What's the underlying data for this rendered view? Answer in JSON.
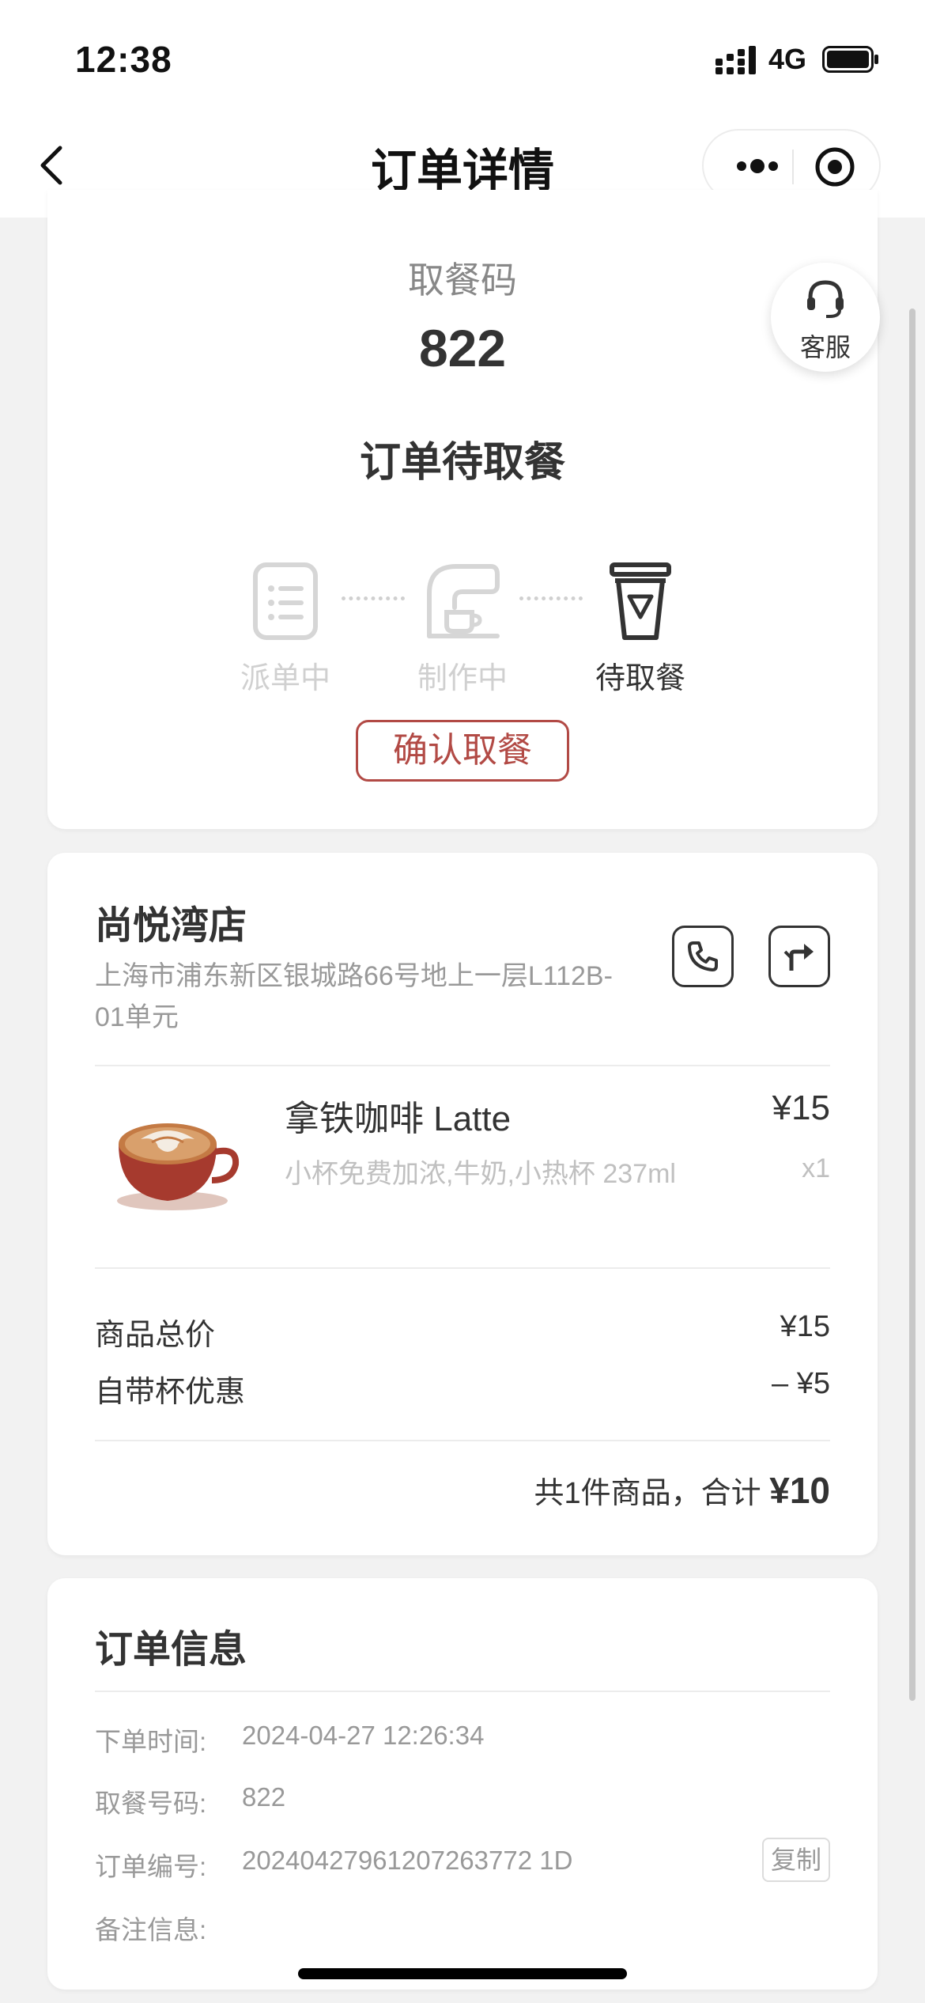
{
  "status_bar": {
    "time": "12:38",
    "network": "4G"
  },
  "nav": {
    "title": "订单详情"
  },
  "pickup": {
    "label": "取餐码",
    "code": "822",
    "status": "订单待取餐",
    "steps": [
      {
        "label": "派单中",
        "icon": "clipboard-icon",
        "active": false
      },
      {
        "label": "制作中",
        "icon": "coffee-machine-icon",
        "active": false
      },
      {
        "label": "待取餐",
        "icon": "cup-icon",
        "active": true
      }
    ],
    "confirm_button": "确认取餐"
  },
  "customer_service": {
    "label": "客服"
  },
  "store": {
    "name": "尚悦湾店",
    "address": "上海市浦东新区银城路66号地上一层L112B-01单元",
    "product": {
      "name": "拿铁咖啡 Latte",
      "spec": "小杯免费加浓,牛奶,小热杯 237ml",
      "price": "¥15",
      "qty": "x1"
    },
    "subtotal_label": "商品总价",
    "subtotal_value": "¥15",
    "discount_label": "自带杯优惠",
    "discount_value": "– ¥5",
    "summary_prefix": "共1件商品，合计",
    "summary_total": "¥10"
  },
  "order_info": {
    "title": "订单信息",
    "rows": [
      {
        "label": "下单时间:",
        "value": "2024-04-27 12:26:34"
      },
      {
        "label": "取餐号码:",
        "value": "822"
      },
      {
        "label": "订单编号:",
        "value": "20240427961207263772 1D"
      },
      {
        "label": "备注信息:",
        "value": ""
      }
    ],
    "copy_button": "复制"
  },
  "colors": {
    "accent": "#b24a45",
    "inactive": "#d0d0d0",
    "background": "#f2f2f2"
  }
}
